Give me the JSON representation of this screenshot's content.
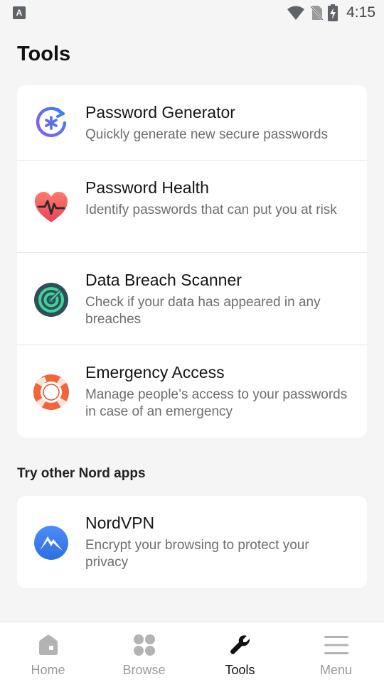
{
  "status_bar": {
    "left_icon_letter": "A",
    "time": "4:15",
    "icons": [
      "wifi-icon",
      "no-sim-icon",
      "battery-charging-icon"
    ]
  },
  "page": {
    "title": "Tools"
  },
  "tools": [
    {
      "icon": "password-generator-icon",
      "title": "Password Generator",
      "description": "Quickly generate new secure passwords"
    },
    {
      "icon": "password-health-icon",
      "title": "Password Health",
      "description": "Identify passwords that can put you at risk"
    },
    {
      "icon": "data-breach-scanner-icon",
      "title": "Data Breach Scanner",
      "description": "Check if your data has appeared in any breaches"
    },
    {
      "icon": "emergency-access-icon",
      "title": "Emergency Access",
      "description": "Manage people’s access to your passwords in case of an emergency"
    }
  ],
  "other_apps": {
    "heading": "Try other Nord apps",
    "items": [
      {
        "icon": "nordvpn-icon",
        "title": "NordVPN",
        "description": "Encrypt your browsing to protect your privacy"
      }
    ]
  },
  "bottom_nav": {
    "items": [
      {
        "label": "Home",
        "icon": "home-icon",
        "active": false
      },
      {
        "label": "Browse",
        "icon": "browse-grid-icon",
        "active": false
      },
      {
        "label": "Tools",
        "icon": "wrench-icon",
        "active": true
      },
      {
        "label": "Menu",
        "icon": "menu-icon",
        "active": false
      }
    ]
  },
  "colors": {
    "background": "#f5f5f5",
    "card": "#ffffff",
    "accent_blue": "#3b7ff5",
    "health_red": "#f05a5a",
    "breach_dark": "#2f4f57",
    "breach_green": "#3fd39a",
    "emergency_orange": "#f2643a",
    "nav_inactive": "#9a9a9a",
    "nav_active": "#111111"
  }
}
